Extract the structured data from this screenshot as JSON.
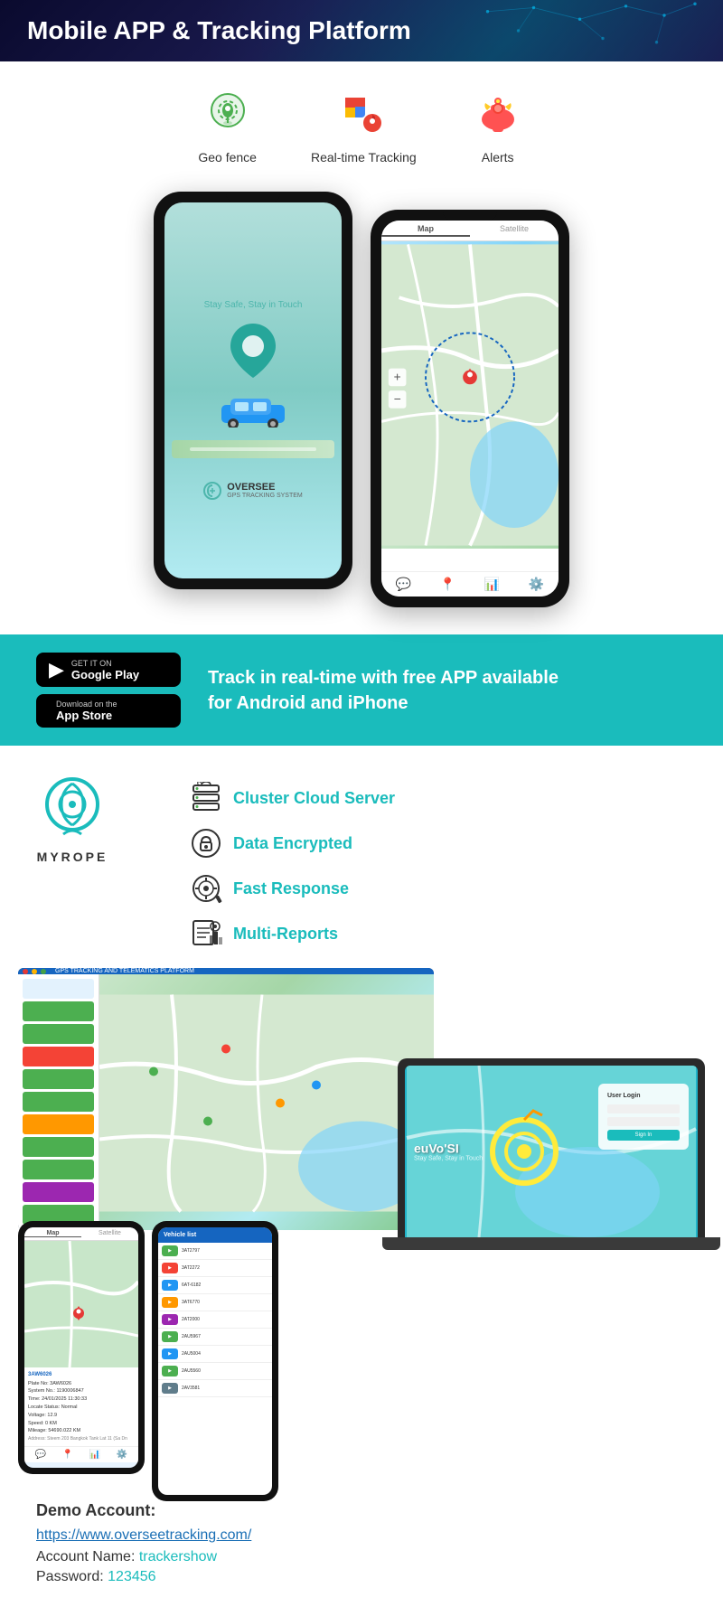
{
  "header": {
    "title": "Mobile APP & Tracking Platform"
  },
  "features": {
    "items": [
      {
        "label": "Geo fence",
        "icon": "📍"
      },
      {
        "label": "Real-time Tracking",
        "icon": "🗺️"
      },
      {
        "label": "Alerts",
        "icon": "🚨"
      }
    ]
  },
  "appstore": {
    "google_play_small": "GET IT ON",
    "google_play_name": "Google Play",
    "apple_small": "Download on the",
    "apple_name": "App Store",
    "tagline": "Track in real-time with free APP available\nfor Android and iPhone"
  },
  "myrope": {
    "brand_name": "MYROPE",
    "features": [
      {
        "label": "Cluster Cloud Server"
      },
      {
        "label": "Data Encrypted"
      },
      {
        "label": "Fast Response"
      },
      {
        "label": "Multi-Reports"
      }
    ]
  },
  "gps_app": {
    "tagline": "Stay Safe, Stay in Touch",
    "brand": "OVERSEE",
    "sub": "GPS TRACKING SYSTEM"
  },
  "demo": {
    "title": "Demo Account:",
    "link": "https://www.overseetracking.com/",
    "account_label": "Account Name: ",
    "account_value": "trackershow",
    "password_label": "Password: ",
    "password_value": "123456"
  },
  "vehicle_list": {
    "title": "Vehicle list",
    "items": [
      {
        "id": "3AT2797",
        "color": "#4caf50"
      },
      {
        "id": "3AT2272",
        "color": "#f44336"
      },
      {
        "id": "6AT-6182",
        "color": "#2196f3"
      },
      {
        "id": "3AT6770",
        "color": "#ff9800"
      },
      {
        "id": "2AT2000",
        "color": "#9c27b0"
      },
      {
        "id": "2AU5967",
        "color": "#4caf50"
      },
      {
        "id": "2AU5004",
        "color": "#2196f3"
      },
      {
        "id": "2AU5560",
        "color": "#4caf50"
      },
      {
        "id": "2AV3581",
        "color": "#607d8b"
      }
    ]
  }
}
